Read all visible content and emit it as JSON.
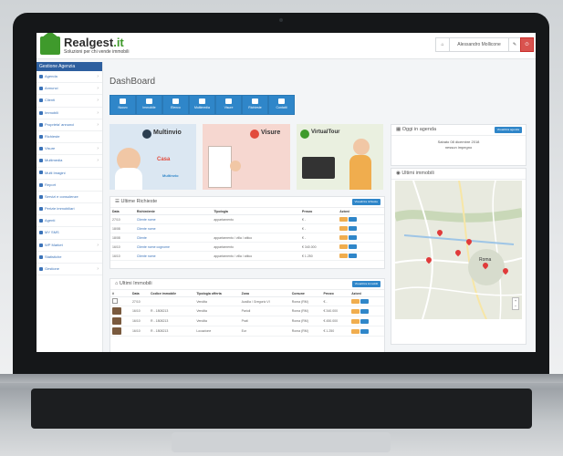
{
  "brand": {
    "name": "Realgest",
    "suffix": ".it",
    "tagline": "Soluzioni per chi vende immobili"
  },
  "header": {
    "home_icon": "home-icon",
    "user": "Alessandro Mollicone",
    "wrench_icon": "wrench-icon",
    "power_icon": "power-icon"
  },
  "sidebar": {
    "title": "Gestione Agenzia",
    "items": [
      {
        "label": "Agenda",
        "caret": "›"
      },
      {
        "label": "Annunci",
        "caret": "›"
      },
      {
        "label": "Clienti",
        "caret": "›"
      },
      {
        "label": "Immobili",
        "caret": "›"
      },
      {
        "label": "Proprieta' annunci",
        "caret": "›"
      },
      {
        "label": "Richieste",
        "caret": ""
      },
      {
        "label": "Visure",
        "caret": "›"
      },
      {
        "label": "Multimedia",
        "caret": "›"
      },
      {
        "label": "Multi Imagini",
        "caret": ""
      },
      {
        "label": "Report",
        "caret": ""
      },
      {
        "label": "Servizi e consulenze",
        "caret": ""
      },
      {
        "label": "Perizie immobiliari",
        "caret": ""
      },
      {
        "label": "Agenti",
        "caret": ""
      },
      {
        "label": "MY SMS",
        "caret": ""
      },
      {
        "label": "WP Market",
        "caret": "›"
      },
      {
        "label": "Statistiche",
        "caret": ""
      },
      {
        "label": "Gestione",
        "caret": "›"
      }
    ]
  },
  "page_title": "DashBoard",
  "quick": [
    "Nuovo",
    "Immobile",
    "Elenco",
    "Multimedia",
    "Visure",
    "Richieste",
    "Contatti"
  ],
  "banners": {
    "multinvio": {
      "title": "Multinvio",
      "tag1": "Casa",
      "tag2": "Multinvio"
    },
    "visure": {
      "title": "Visure"
    },
    "virtualtour": {
      "title": "VirtualTour"
    }
  },
  "richieste": {
    "title": "Ultime Richieste",
    "button": "Visualizza richieste",
    "columns": [
      "Data",
      "Richiedente",
      "Tipologia",
      "Prezzo",
      "Azioni"
    ],
    "rows": [
      {
        "data": "27/10",
        "richiedente": "Cliente nome",
        "tipologia": "appartamento",
        "prezzo": "€ -"
      },
      {
        "data": "18/08",
        "richiedente": "Cliente nome",
        "tipologia": "",
        "prezzo": "€ -"
      },
      {
        "data": "18/08",
        "richiedente": "Cliente",
        "tipologia": "appartamento / villa / attico",
        "prezzo": "€ -"
      },
      {
        "data": "16/10",
        "richiedente": "Cliente nome cognome",
        "tipologia": "appartamento",
        "prezzo": "€ 340.000"
      },
      {
        "data": "16/10",
        "richiedente": "Cliente nome",
        "tipologia": "appartamento / villa / attico",
        "prezzo": "€ 1.250"
      }
    ]
  },
  "immobili": {
    "title": "Ultimi Immobili",
    "button": "Visualizza immobili",
    "columns": [
      "#",
      "Data",
      "Codice immobile",
      "Tipologia offerta",
      "Zona",
      "Comune",
      "Prezzo",
      "Azioni"
    ],
    "rows": [
      {
        "data": "27/10",
        "codice": "",
        "tipologia": "Vendita",
        "zona": "Ausilia / Gregorio VI",
        "comune": "Roma (RM)",
        "prezzo": "€ -"
      },
      {
        "data": "16/10",
        "codice": "R - 1808213",
        "tipologia": "Vendita",
        "zona": "Parioli",
        "comune": "Roma (RM)",
        "prezzo": "€ 340.000"
      },
      {
        "data": "16/10",
        "codice": "R - 1808213",
        "tipologia": "Vendita",
        "zona": "Prati",
        "comune": "Roma (RM)",
        "prezzo": "€ 450.000"
      },
      {
        "data": "16/10",
        "codice": "R - 1808213",
        "tipologia": "Locazione",
        "zona": "Eur",
        "comune": "Roma (RM)",
        "prezzo": "€ 1.250"
      }
    ]
  },
  "agenda": {
    "title": "Oggi in agenda",
    "button": "Visualizza agenda",
    "date": "Sabato 08 dicembre 2018",
    "empty": "nessun impegno"
  },
  "map_panel": {
    "title": "Ultimi immobili",
    "city": "Roma",
    "zoom_in": "+",
    "zoom_out": "−"
  },
  "colors": {
    "primary": "#2f86c9",
    "brand_green": "#3f9a2c",
    "danger": "#d9534f",
    "warning": "#f0ad4e",
    "sidebar_head": "#2d5f9f"
  }
}
